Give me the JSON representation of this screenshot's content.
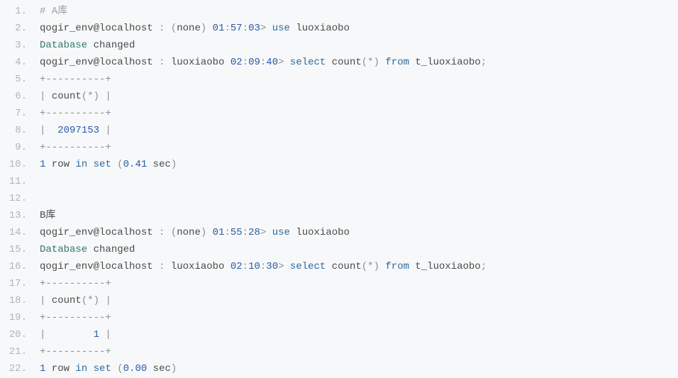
{
  "lines": [
    [
      {
        "cls": "c-comment",
        "t": "# A库"
      }
    ],
    [
      {
        "cls": "c-text",
        "t": "qogir_env@localhost "
      },
      {
        "cls": "c-punc",
        "t": ": "
      },
      {
        "cls": "c-punc",
        "t": "("
      },
      {
        "cls": "c-text",
        "t": "none"
      },
      {
        "cls": "c-punc",
        "t": ") "
      },
      {
        "cls": "c-num",
        "t": "01"
      },
      {
        "cls": "c-punc",
        "t": ":"
      },
      {
        "cls": "c-num",
        "t": "57"
      },
      {
        "cls": "c-punc",
        "t": ":"
      },
      {
        "cls": "c-num",
        "t": "03"
      },
      {
        "cls": "c-punc",
        "t": "> "
      },
      {
        "cls": "c-kw",
        "t": "use"
      },
      {
        "cls": "c-text",
        "t": " luoxiaobo"
      }
    ],
    [
      {
        "cls": "c-green",
        "t": "Database"
      },
      {
        "cls": "c-text",
        "t": " changed"
      }
    ],
    [
      {
        "cls": "c-text",
        "t": "qogir_env@localhost "
      },
      {
        "cls": "c-punc",
        "t": ": "
      },
      {
        "cls": "c-text",
        "t": "luoxiaobo "
      },
      {
        "cls": "c-num",
        "t": "02"
      },
      {
        "cls": "c-punc",
        "t": ":"
      },
      {
        "cls": "c-num",
        "t": "09"
      },
      {
        "cls": "c-punc",
        "t": ":"
      },
      {
        "cls": "c-num",
        "t": "40"
      },
      {
        "cls": "c-punc",
        "t": "> "
      },
      {
        "cls": "c-kw",
        "t": "select"
      },
      {
        "cls": "c-text",
        "t": " count"
      },
      {
        "cls": "c-punc",
        "t": "("
      },
      {
        "cls": "c-punc",
        "t": "*"
      },
      {
        "cls": "c-punc",
        "t": ") "
      },
      {
        "cls": "c-kw",
        "t": "from"
      },
      {
        "cls": "c-text",
        "t": " t_luoxiaobo"
      },
      {
        "cls": "c-punc",
        "t": ";"
      }
    ],
    [
      {
        "cls": "c-punc",
        "t": "+----------+"
      }
    ],
    [
      {
        "cls": "c-punc",
        "t": "| "
      },
      {
        "cls": "c-text",
        "t": "count"
      },
      {
        "cls": "c-punc",
        "t": "("
      },
      {
        "cls": "c-punc",
        "t": "*"
      },
      {
        "cls": "c-punc",
        "t": ")"
      },
      {
        "cls": "c-punc",
        "t": " |"
      }
    ],
    [
      {
        "cls": "c-punc",
        "t": "+----------+"
      }
    ],
    [
      {
        "cls": "c-punc",
        "t": "|  "
      },
      {
        "cls": "c-num",
        "t": "2097153"
      },
      {
        "cls": "c-punc",
        "t": " |"
      }
    ],
    [
      {
        "cls": "c-punc",
        "t": "+----------+"
      }
    ],
    [
      {
        "cls": "c-num",
        "t": "1"
      },
      {
        "cls": "c-text",
        "t": " row "
      },
      {
        "cls": "c-kw",
        "t": "in"
      },
      {
        "cls": "c-text",
        "t": " "
      },
      {
        "cls": "c-kw",
        "t": "set"
      },
      {
        "cls": "c-text",
        "t": " "
      },
      {
        "cls": "c-punc",
        "t": "("
      },
      {
        "cls": "c-num",
        "t": "0.41"
      },
      {
        "cls": "c-text",
        "t": " sec"
      },
      {
        "cls": "c-punc",
        "t": ")"
      }
    ],
    [],
    [],
    [
      {
        "cls": "c-text",
        "t": "B库"
      }
    ],
    [
      {
        "cls": "c-text",
        "t": "qogir_env@localhost "
      },
      {
        "cls": "c-punc",
        "t": ": "
      },
      {
        "cls": "c-punc",
        "t": "("
      },
      {
        "cls": "c-text",
        "t": "none"
      },
      {
        "cls": "c-punc",
        "t": ") "
      },
      {
        "cls": "c-num",
        "t": "01"
      },
      {
        "cls": "c-punc",
        "t": ":"
      },
      {
        "cls": "c-num",
        "t": "55"
      },
      {
        "cls": "c-punc",
        "t": ":"
      },
      {
        "cls": "c-num",
        "t": "28"
      },
      {
        "cls": "c-punc",
        "t": "> "
      },
      {
        "cls": "c-kw",
        "t": "use"
      },
      {
        "cls": "c-text",
        "t": " luoxiaobo"
      }
    ],
    [
      {
        "cls": "c-green",
        "t": "Database"
      },
      {
        "cls": "c-text",
        "t": " changed"
      }
    ],
    [
      {
        "cls": "c-text",
        "t": "qogir_env@localhost "
      },
      {
        "cls": "c-punc",
        "t": ": "
      },
      {
        "cls": "c-text",
        "t": "luoxiaobo "
      },
      {
        "cls": "c-num",
        "t": "02"
      },
      {
        "cls": "c-punc",
        "t": ":"
      },
      {
        "cls": "c-num",
        "t": "10"
      },
      {
        "cls": "c-punc",
        "t": ":"
      },
      {
        "cls": "c-num",
        "t": "30"
      },
      {
        "cls": "c-punc",
        "t": "> "
      },
      {
        "cls": "c-kw",
        "t": "select"
      },
      {
        "cls": "c-text",
        "t": " count"
      },
      {
        "cls": "c-punc",
        "t": "("
      },
      {
        "cls": "c-punc",
        "t": "*"
      },
      {
        "cls": "c-punc",
        "t": ") "
      },
      {
        "cls": "c-kw",
        "t": "from"
      },
      {
        "cls": "c-text",
        "t": " t_luoxiaobo"
      },
      {
        "cls": "c-punc",
        "t": ";"
      }
    ],
    [
      {
        "cls": "c-punc",
        "t": "+----------+"
      }
    ],
    [
      {
        "cls": "c-punc",
        "t": "| "
      },
      {
        "cls": "c-text",
        "t": "count"
      },
      {
        "cls": "c-punc",
        "t": "("
      },
      {
        "cls": "c-punc",
        "t": "*"
      },
      {
        "cls": "c-punc",
        "t": ")"
      },
      {
        "cls": "c-punc",
        "t": " |"
      }
    ],
    [
      {
        "cls": "c-punc",
        "t": "+----------+"
      }
    ],
    [
      {
        "cls": "c-punc",
        "t": "|        "
      },
      {
        "cls": "c-num",
        "t": "1"
      },
      {
        "cls": "c-punc",
        "t": " |"
      }
    ],
    [
      {
        "cls": "c-punc",
        "t": "+----------+"
      }
    ],
    [
      {
        "cls": "c-num",
        "t": "1"
      },
      {
        "cls": "c-text",
        "t": " row "
      },
      {
        "cls": "c-kw",
        "t": "in"
      },
      {
        "cls": "c-text",
        "t": " "
      },
      {
        "cls": "c-kw",
        "t": "set"
      },
      {
        "cls": "c-text",
        "t": " "
      },
      {
        "cls": "c-punc",
        "t": "("
      },
      {
        "cls": "c-num",
        "t": "0.00"
      },
      {
        "cls": "c-text",
        "t": " sec"
      },
      {
        "cls": "c-punc",
        "t": ")"
      }
    ]
  ]
}
